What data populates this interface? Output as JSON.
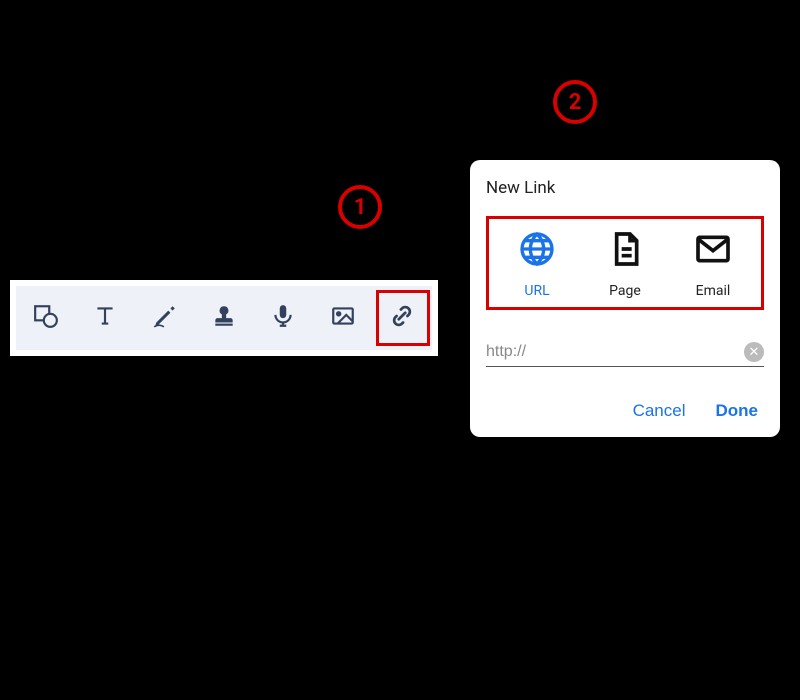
{
  "steps": {
    "one": "1",
    "two": "2"
  },
  "toolbar": {
    "items": [
      "shape",
      "text",
      "pen",
      "stamp",
      "voice",
      "image",
      "link"
    ]
  },
  "dialog": {
    "title": "New Link",
    "types": {
      "url": {
        "label": "URL"
      },
      "page": {
        "label": "Page"
      },
      "email": {
        "label": "Email"
      }
    },
    "url_value": "http://",
    "cancel_label": "Cancel",
    "done_label": "Done"
  }
}
